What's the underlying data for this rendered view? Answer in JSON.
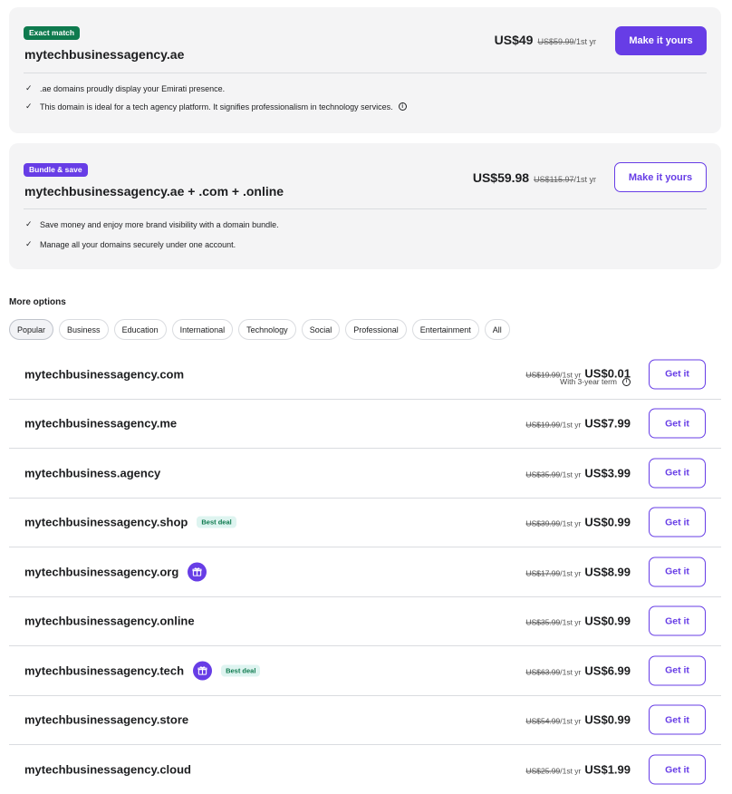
{
  "exact_match": {
    "badge": "Exact match",
    "domain": "mytechbusinessagency.ae",
    "price": "US$49",
    "old_price": "US$59.99",
    "period": "/1st yr",
    "button": "Make it yours",
    "features": [
      ".ae domains proudly display your Emirati presence.",
      "This domain is ideal for a tech agency platform. It signifies professionalism in technology services."
    ]
  },
  "bundle": {
    "badge": "Bundle & save",
    "domain": "mytechbusinessagency.ae + .com + .online",
    "price": "US$59.98",
    "old_price": "US$115.97",
    "period": "/1st yr",
    "button": "Make it yours",
    "features": [
      "Save money and enjoy more brand visibility with a domain bundle.",
      "Manage all your domains securely under one account."
    ]
  },
  "more_options": {
    "title": "More options",
    "filters": [
      "Popular",
      "Business",
      "Education",
      "International",
      "Technology",
      "Social",
      "Professional",
      "Entertainment",
      "All"
    ],
    "selected_filter": "Popular"
  },
  "domains": [
    {
      "name": "mytechbusinessagency.com",
      "old_price": "US$19.99",
      "period": "/1st yr",
      "price": "US$0.01",
      "note": "With 3-year term",
      "button": "Get it"
    },
    {
      "name": "mytechbusinessagency.me",
      "old_price": "US$19.99",
      "period": "/1st yr",
      "price": "US$7.99",
      "button": "Get it"
    },
    {
      "name": "mytechbusiness.agency",
      "old_price": "US$35.99",
      "period": "/1st yr",
      "price": "US$3.99",
      "button": "Get it"
    },
    {
      "name": "mytechbusinessagency.shop",
      "badge": "Best deal",
      "old_price": "US$39.99",
      "period": "/1st yr",
      "price": "US$0.99",
      "button": "Get it"
    },
    {
      "name": "mytechbusinessagency.org",
      "gift": true,
      "old_price": "US$17.99",
      "period": "/1st yr",
      "price": "US$8.99",
      "button": "Get it"
    },
    {
      "name": "mytechbusinessagency.online",
      "old_price": "US$35.99",
      "period": "/1st yr",
      "price": "US$0.99",
      "button": "Get it"
    },
    {
      "name": "mytechbusinessagency.tech",
      "gift": true,
      "badge": "Best deal",
      "old_price": "US$63.99",
      "period": "/1st yr",
      "price": "US$6.99",
      "button": "Get it"
    },
    {
      "name": "mytechbusinessagency.store",
      "old_price": "US$54.99",
      "period": "/1st yr",
      "price": "US$0.99",
      "button": "Get it"
    },
    {
      "name": "mytechbusinessagency.cloud",
      "old_price": "US$25.99",
      "period": "/1st yr",
      "price": "US$1.99",
      "button": "Get it"
    }
  ],
  "colors": {
    "accent": "#673de6",
    "success": "#0e7a4e",
    "card_bg": "#f4f4f5"
  }
}
